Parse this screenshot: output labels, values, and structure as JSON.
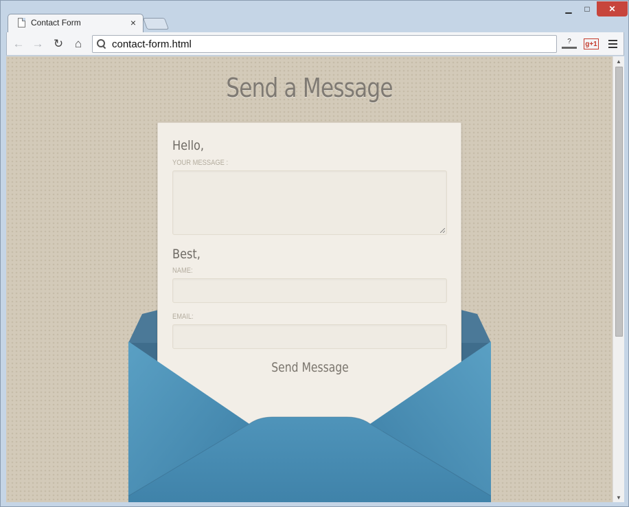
{
  "browser": {
    "tab_title": "Contact Form",
    "tab_close": "×",
    "url": "contact-form.html",
    "nav": {
      "back": "←",
      "forward": "→",
      "reload": "↻",
      "home": "⌂"
    },
    "toolbar": {
      "help": "?",
      "gplus": "g+1"
    },
    "window": {
      "minimize": "▁",
      "maximize": "□",
      "close": "✕"
    }
  },
  "page": {
    "title": "Send a Message",
    "greeting": "Hello,",
    "message_label": "YOUR MESSAGE :",
    "signoff": "Best,",
    "name_label": "NAME:",
    "email_label": "EMAIL:",
    "submit_label": "Send Message"
  },
  "colors": {
    "background": "#d3cab9",
    "paper": "#f2eee7",
    "envelope": "#4a8fb3",
    "title": "#7f7a73"
  },
  "icons": {
    "tab": "page-icon",
    "omnibox": "search-icon",
    "menu": "hamburger-menu-icon"
  }
}
